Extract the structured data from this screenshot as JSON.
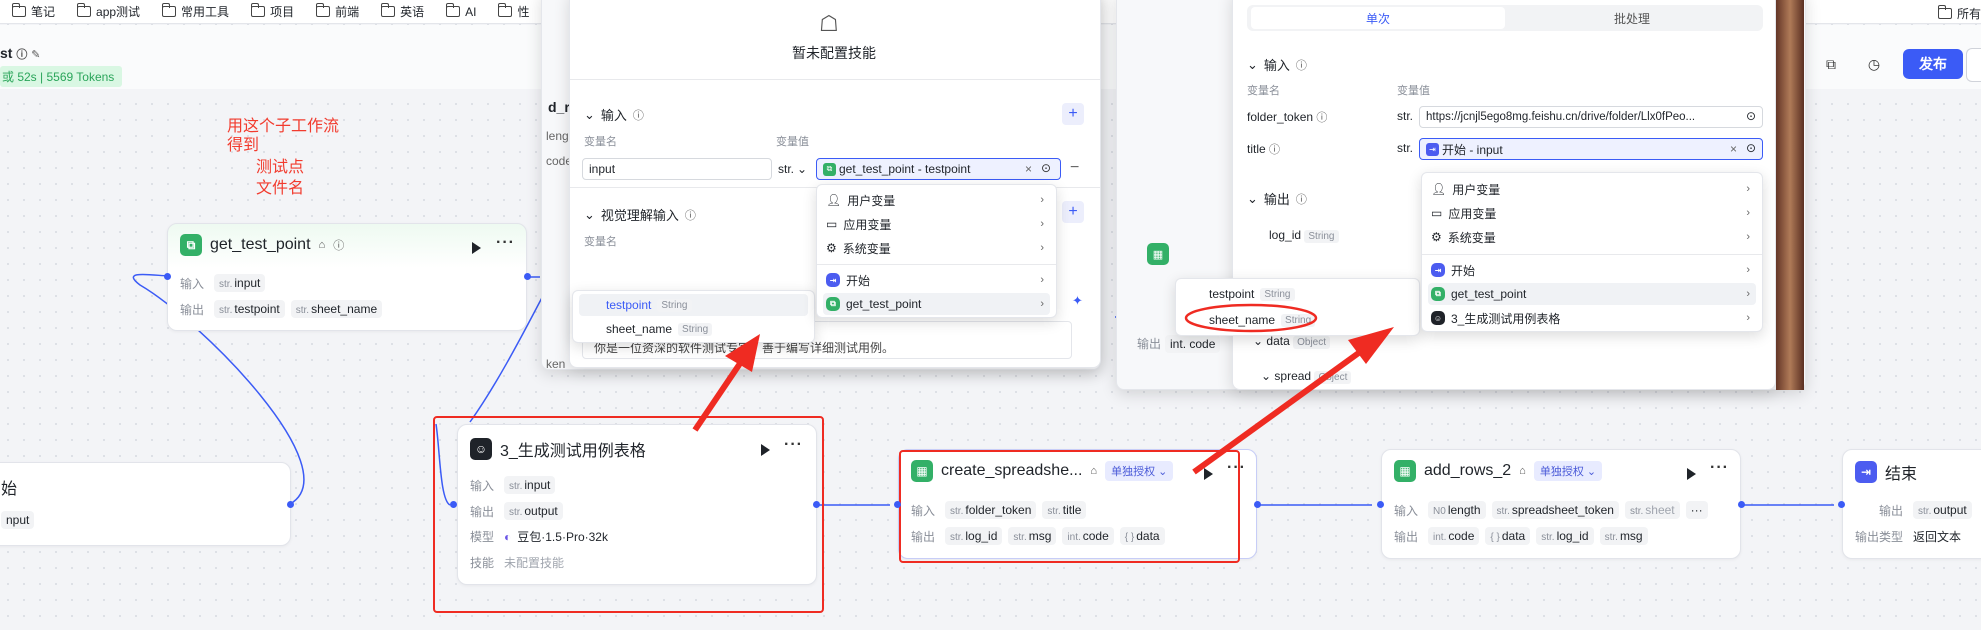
{
  "bookmarks": [
    "笔记",
    "app测试",
    "常用工具",
    "项目",
    "前端",
    "英语",
    "AI",
    "性"
  ],
  "bookmarks_right": "所有",
  "header": {
    "title": "st",
    "badge": "或 52s | 5569 Tokens",
    "publish_label": "发布"
  },
  "annotation": {
    "line1": "用这个子工作流",
    "line2": "得到",
    "line3": "测试点",
    "line4": "文件名"
  },
  "nodes": {
    "start": {
      "title": "始",
      "out_tag": "nput"
    },
    "get_test_point": {
      "title": "get_test_point",
      "in_label": "输入",
      "in_val": "input",
      "out_label": "输出",
      "out_val1": "testpoint",
      "out_val2": "sheet_name"
    },
    "gen_table": {
      "title": "3_生成测试用例表格",
      "in_label": "输入",
      "in_val": "input",
      "out_label": "输出",
      "out_val": "output",
      "model_label": "模型",
      "model_val": "豆包·1.5·Pro·32k",
      "skill_label": "技能",
      "skill_val": "未配置技能"
    },
    "create_sheet": {
      "title": "create_spreadshe...",
      "auth": "单独授权",
      "in_label": "输入",
      "in_val1": "folder_token",
      "in_val2": "title",
      "out_label": "输出",
      "out_val1": "log_id",
      "out_val2": "msg",
      "out_val3": "code",
      "out_val4": "data"
    },
    "add_rows": {
      "title": "add_rows_2",
      "auth": "单独授权",
      "in_label": "输入",
      "in_val1": "length",
      "in_val2": "spreadsheet_token",
      "in_val3": "sheet",
      "out_label": "输出",
      "out_val1": "code",
      "out_val2": "data",
      "out_val3": "log_id",
      "out_val4": "msg"
    },
    "end": {
      "title": "结束",
      "out_label": "输出",
      "out_val": "output",
      "type_label": "输出类型",
      "type_val": "返回文本"
    }
  },
  "left_panel": {
    "no_skill": "暂未配置技能",
    "input_section": "输入",
    "col_name": "变量名",
    "col_value": "变量值",
    "var_name": "input",
    "var_type": "str.",
    "var_ref": "get_test_point - testpoint",
    "vision_section": "视觉理解输入",
    "vision_col_name": "变量名",
    "prompt_text": "你是一位资深的软件测试专家，善于编写详细测试用例。",
    "clipped_label_a": "d_r",
    "clipped_label_b": "leng",
    "clipped_label_c": "code",
    "clipped_label_d": "ken",
    "menu": {
      "user": "用户变量",
      "app": "应用变量",
      "system": "系统变量",
      "start": "开始",
      "gtp": "get_test_point"
    },
    "submenu": {
      "item1": "testpoint",
      "item1_type": "String",
      "item2": "sheet_name",
      "item2_type": "String"
    }
  },
  "right_panel": {
    "tab_single": "单次",
    "tab_batch": "批处理",
    "input_section": "输入",
    "col_name": "变量名",
    "col_value": "变量值",
    "row1_name": "folder_token",
    "row1_type": "str.",
    "row1_value": "https://jcnjl5ego8mg.feishu.cn/drive/folder/Llx0fPeo...",
    "row2_name": "title",
    "row2_type": "str.",
    "row2_value": "开始 - input",
    "output_section": "输出",
    "out1": "log_id",
    "out1_type": "String",
    "out_data": "data",
    "out_data_type": "Object",
    "out_spread": "spread",
    "out_spread_type": "Object",
    "clipped_label": "int. code",
    "menu": {
      "user": "用户变量",
      "app": "应用变量",
      "system": "系统变量",
      "start": "开始",
      "gtp": "get_test_point",
      "gen": "3_生成测试用例表格"
    },
    "submenu": {
      "item1": "testpoint",
      "item1_type": "String",
      "item2": "sheet_name",
      "item2_type": "String"
    }
  },
  "colors": {
    "accent": "#3b5bf6",
    "annotation_red": "#ef2b22",
    "success_green": "#33b067"
  }
}
